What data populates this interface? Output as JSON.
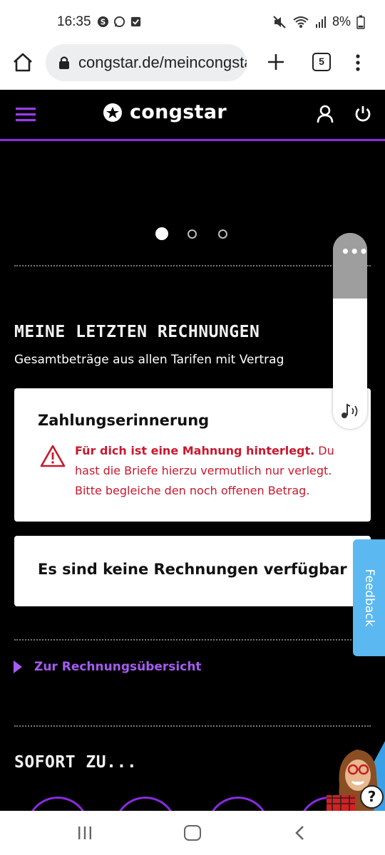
{
  "status_bar": {
    "time": "16:35",
    "battery": "8%",
    "icons": [
      "skype-icon",
      "whatsapp-icon",
      "checkbox-icon",
      "mute-icon",
      "wifi-icon",
      "signal-icon",
      "battery-icon"
    ]
  },
  "browser": {
    "url": "congstar.de/meincongstar",
    "tab_count": "5"
  },
  "site_header": {
    "brand": "congstar",
    "accent_color": "#8a2be2"
  },
  "carousel": {
    "slide_count": 3,
    "active_index": 0
  },
  "invoices": {
    "title": "MEINE LETZTEN RECHNUNGEN",
    "subtitle": "Gesamtbeträge aus allen Tarifen mit Vertrag",
    "reminder": {
      "title": "Zahlungserinnerung",
      "warning_bold": "Für dich ist eine Mahnung hinterlegt.",
      "warning_text": " Du hast die Briefe hierzu vermutlich nur verlegt. Bitte begleiche den noch offenen Betrag.",
      "warning_color": "#c9182e"
    },
    "empty_message": "Es sind keine Rechnungen verfügbar",
    "overview_link": "Zur Rechnungsübersicht"
  },
  "sofort": {
    "title": "SOFORT ZU..."
  },
  "overlays": {
    "feedback_label": "Feedback",
    "help_label": "?",
    "more_label": "•••"
  }
}
